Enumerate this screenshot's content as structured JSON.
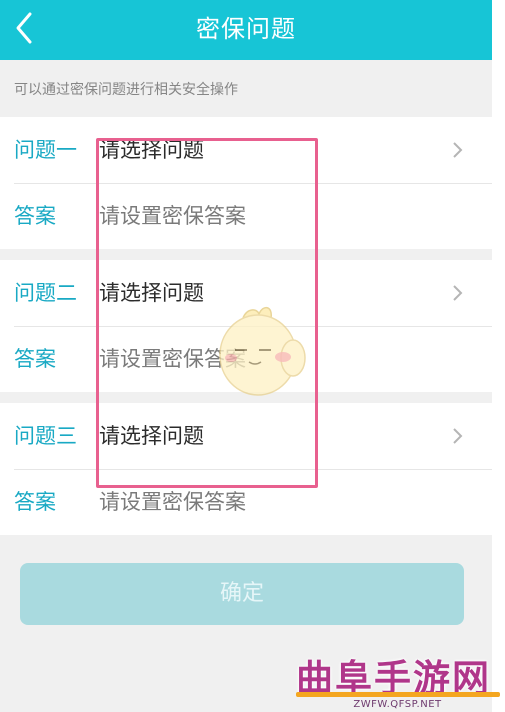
{
  "header": {
    "title": "密保问题",
    "back_icon": "chevron-left-icon"
  },
  "hint": "可以通过密保问题进行相关安全操作",
  "groups": [
    {
      "question_label": "问题一",
      "question_value": "请选择问题",
      "answer_label": "答案",
      "answer_value": "请设置密保答案"
    },
    {
      "question_label": "问题二",
      "question_value": "请选择问题",
      "answer_label": "答案",
      "answer_value": "请设置密保答案"
    },
    {
      "question_label": "问题三",
      "question_value": "请选择问题",
      "answer_label": "答案",
      "answer_value": "请设置密保答案"
    }
  ],
  "confirm_label": "确定",
  "watermark": {
    "title": "曲阜手游网",
    "url": "ZWFW.QFSP.NET"
  },
  "colors": {
    "header": "#17c5d6",
    "label": "#19a9c4",
    "button": "#a9dadf",
    "highlight": "#e8608f"
  }
}
